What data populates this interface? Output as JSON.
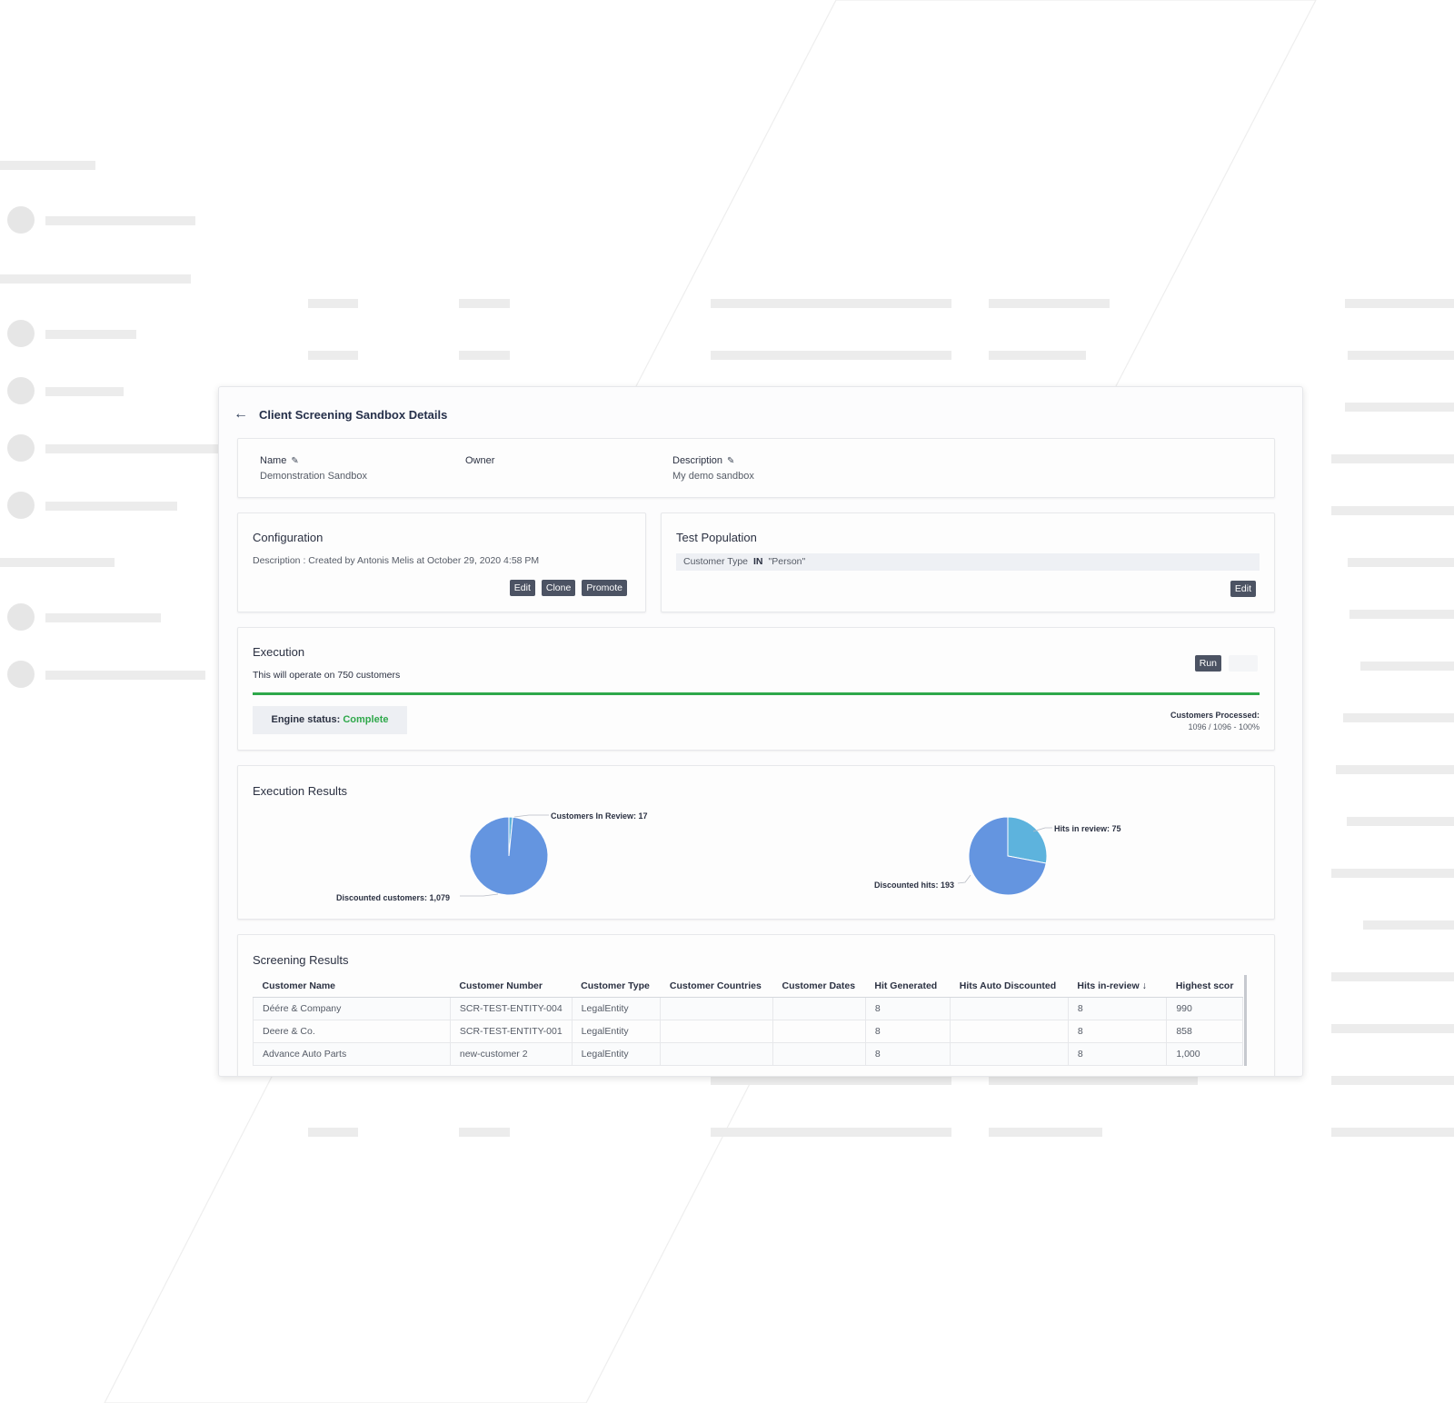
{
  "page": {
    "title": "Client Screening Sandbox Details"
  },
  "info": {
    "name_label": "Name",
    "name_value": "Demonstration Sandbox",
    "owner_label": "Owner",
    "owner_value": "",
    "description_label": "Description",
    "description_value": "My demo sandbox"
  },
  "configuration": {
    "title": "Configuration",
    "description": "Description : Created by Antonis Melis at October 29, 2020 4:58 PM",
    "buttons": {
      "edit": "Edit",
      "clone": "Clone",
      "promote": "Promote"
    }
  },
  "test_population": {
    "title": "Test Population",
    "field": "Customer Type",
    "operator": "IN",
    "value": "\"Person\"",
    "edit": "Edit"
  },
  "execution": {
    "title": "Execution",
    "subtitle": "This will operate on 750 customers",
    "run": "Run",
    "progress_percent": 100,
    "engine_status_label": "Engine status:",
    "engine_status_value": "Complete",
    "processed_label": "Customers Processed:",
    "processed_value": "1096 / 1096 - 100%"
  },
  "execution_results": {
    "title": "Execution Results",
    "customers_in_review_label": "Customers In Review: 17",
    "discounted_customers_label": "Discounted customers: 1,079",
    "hits_in_review_label": "Hits in review: 75",
    "discounted_hits_label": "Discounted hits: 193"
  },
  "chart_data": [
    {
      "type": "pie",
      "slices": [
        {
          "label": "Customers In Review",
          "value": 17,
          "color": "#5db3dd"
        },
        {
          "label": "Discounted customers",
          "value": 1079,
          "color": "#6495e0"
        }
      ]
    },
    {
      "type": "pie",
      "slices": [
        {
          "label": "Hits in review",
          "value": 75,
          "color": "#5db3dd"
        },
        {
          "label": "Discounted hits",
          "value": 193,
          "color": "#6495e0"
        }
      ]
    }
  ],
  "screening_results": {
    "title": "Screening Results",
    "columns": [
      "Customer Name",
      "Customer Number",
      "Customer Type",
      "Customer Countries",
      "Customer Dates",
      "Hit Generated",
      "Hits Auto Discounted",
      "Hits in-review",
      "Highest scor"
    ],
    "sort_icon": "arrow-down-icon",
    "rows": [
      [
        "Déére & Company",
        "SCR-TEST-ENTITY-004",
        "LegalEntity",
        "",
        "",
        "8",
        "",
        "8",
        "990"
      ],
      [
        "Deere & Co.",
        "SCR-TEST-ENTITY-001",
        "LegalEntity",
        "",
        "",
        "8",
        "",
        "8",
        "858"
      ],
      [
        "Advance Auto Parts",
        "new-customer 2",
        "LegalEntity",
        "",
        "",
        "8",
        "",
        "8",
        "1,000"
      ]
    ]
  },
  "colors": {
    "accent_button": "#4c5363",
    "status_complete": "#2ea84a",
    "pie_primary": "#6495e0",
    "pie_secondary": "#5db3dd"
  }
}
